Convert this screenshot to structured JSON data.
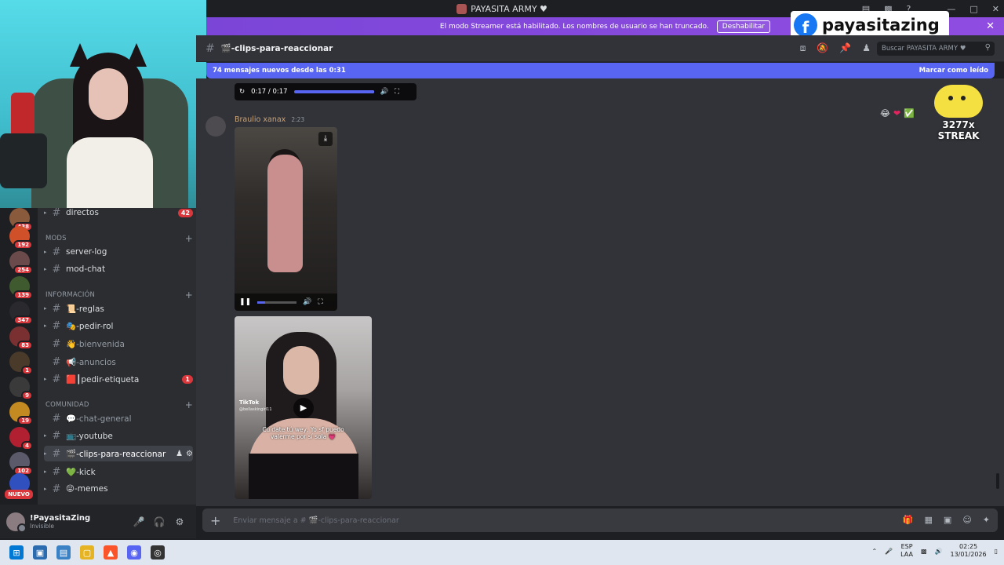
{
  "window": {
    "title": "PAYASITA ARMY ♥"
  },
  "banner": {
    "text": "El modo Streamer está habilitado. Los nombres de usuario se han truncado.",
    "button": "Deshabilitar"
  },
  "overlay": {
    "fb_name": "payasitazing",
    "streak": "3277x STREAK"
  },
  "servers": {
    "badges": [
      "438",
      "192",
      "254",
      "139",
      "347",
      "83",
      "1",
      "9",
      "19",
      "4",
      "102"
    ],
    "new_label": "NUEVO"
  },
  "channels": {
    "top": [
      {
        "label": "directos",
        "count": "42"
      }
    ],
    "mods_category": "MODS",
    "mods": [
      {
        "label": "server-log"
      },
      {
        "label": "mod-chat"
      }
    ],
    "info_category": "INFORMACIÓN",
    "info": [
      {
        "label": "📜-reglas",
        "muted": false
      },
      {
        "label": "🎭-pedir-rol",
        "muted": false
      },
      {
        "label": "👋-bienvenida",
        "muted": true
      },
      {
        "label": "📢-anuncios",
        "muted": true
      },
      {
        "label": "🟥┃pedir-etiqueta",
        "muted": false,
        "count": "1"
      }
    ],
    "community_category": "COMUNIDAD",
    "community": [
      {
        "label": "💬-chat-general",
        "muted": true
      },
      {
        "label": "📺-youtube",
        "muted": false
      },
      {
        "label": "🎬-clips-para-reaccionar",
        "muted": false,
        "active": true
      },
      {
        "label": "💚-kick",
        "muted": false
      },
      {
        "label": "😜-memes",
        "muted": false
      }
    ]
  },
  "user": {
    "name": "!PayasitaZing",
    "status": "Invisible"
  },
  "header": {
    "channel": "🎬-clips-para-reaccionar",
    "search_placeholder": "Buscar PAYASITA ARMY ♥"
  },
  "newbar": {
    "text": "74 mensajes nuevos desde las 0:31",
    "action": "Marcar como leído"
  },
  "player": {
    "time": "0:17 / 0:17"
  },
  "message": {
    "author": "Braulio xanax",
    "time": "2:23"
  },
  "video2": {
    "brand": "TikTok",
    "handle": "@bellaskingirl11",
    "caption": "Cuídate tú wey, Yo sf puedo valerme por sí sola 💗"
  },
  "composer": {
    "placeholder": "Enviar mensaje a # 🎬-clips-para-reaccionar"
  },
  "taskbar": {
    "lang": "ESP",
    "layout": "LAA",
    "time": "02:25",
    "date": "13/01/2026"
  }
}
